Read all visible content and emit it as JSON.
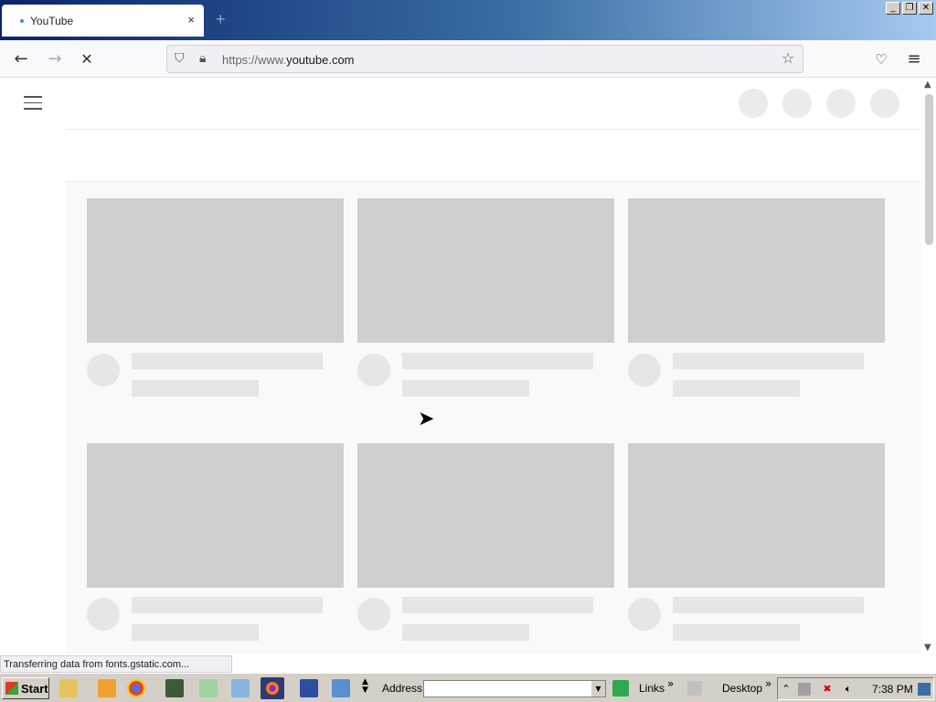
{
  "browser": {
    "tab_title": "YouTube",
    "tab_close": "×",
    "new_tab": "+",
    "url_prefix": "https://www.",
    "url_domain": "youtube.com",
    "status_text": "Transferring data from fonts.gstatic.com..."
  },
  "taskbar": {
    "start_label": "Start",
    "address_label": "Address",
    "address_value": "",
    "links_label": "Links",
    "desktop_label": "Desktop",
    "clock": "7:38 PM"
  },
  "colors": {
    "placeholder_thumb": "#cfcfcf",
    "placeholder_text": "#e6e6e6",
    "title_gradient_start": "#0a246a"
  }
}
